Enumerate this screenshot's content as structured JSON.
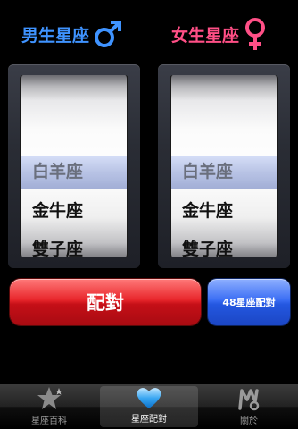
{
  "headers": {
    "male_label": "男生星座",
    "female_label": "女生星座"
  },
  "left_picker": {
    "items": [
      "白羊座",
      "金牛座",
      "雙子座"
    ],
    "selected_index": 0
  },
  "right_picker": {
    "items": [
      "白羊座",
      "金牛座",
      "雙子座"
    ],
    "selected_index": 0
  },
  "buttons": {
    "match_label": "配對",
    "match48_label": "48星座配對"
  },
  "tabbar": {
    "tabs": [
      {
        "label": "星座百科",
        "icon": "star-icon"
      },
      {
        "label": "星座配對",
        "icon": "heart-icon"
      },
      {
        "label": "關於",
        "icon": "about-icon"
      }
    ],
    "active_index": 1
  },
  "colors": {
    "male": "#3f93ff",
    "female": "#ff4f86",
    "match_button": "#e8262b",
    "match48_button": "#3b6ef4"
  }
}
